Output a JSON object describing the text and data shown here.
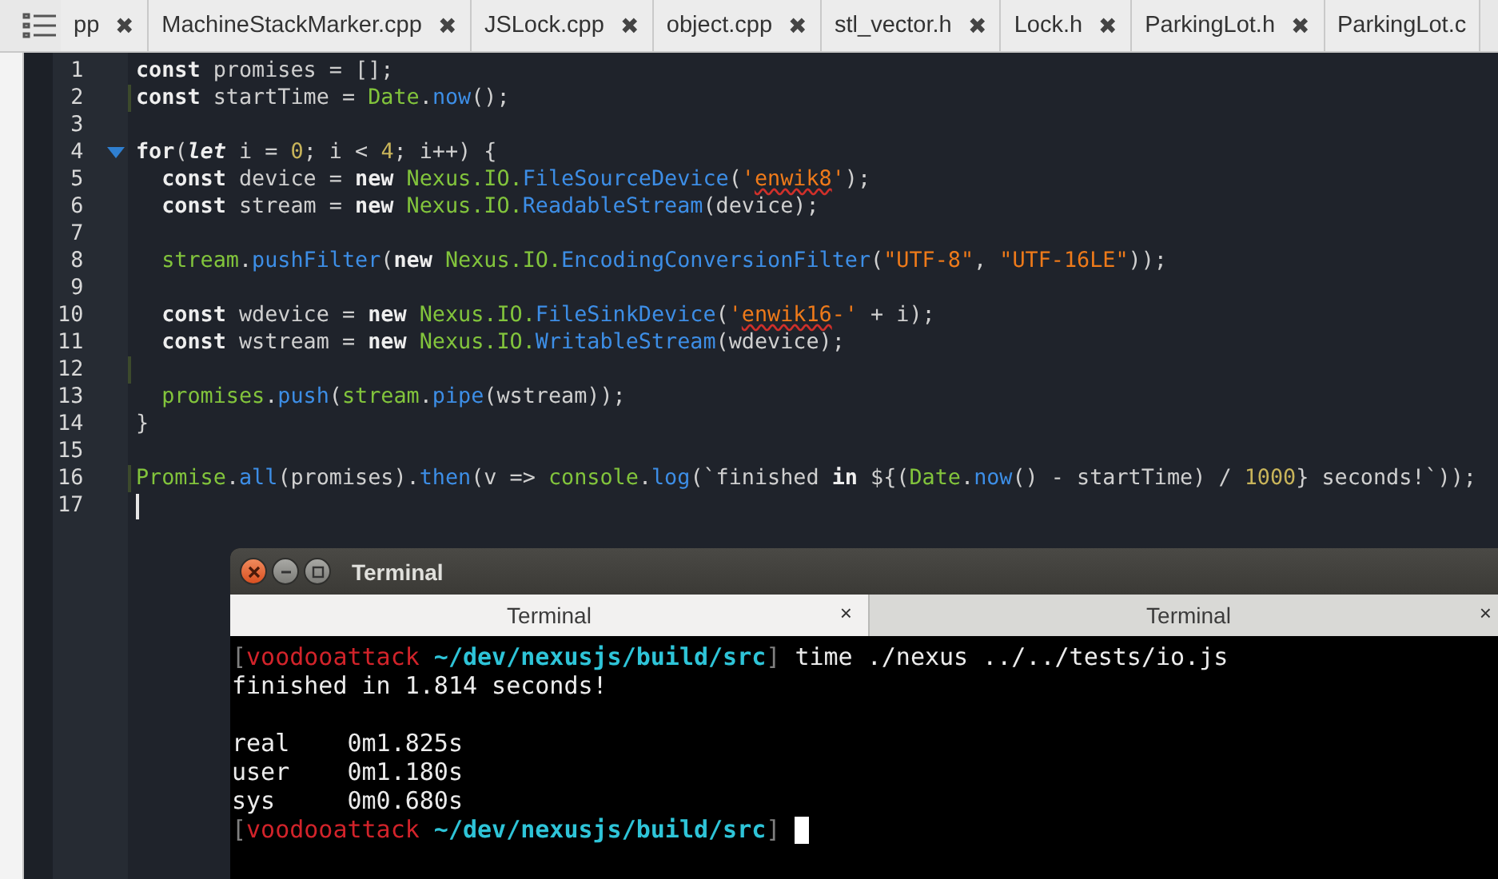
{
  "editor_tabs": [
    {
      "label": "pp",
      "close": "✖",
      "selected": false
    },
    {
      "label": "MachineStackMarker.cpp",
      "close": "✖",
      "selected": false
    },
    {
      "label": "JSLock.cpp",
      "close": "✖",
      "selected": false
    },
    {
      "label": "object.cpp",
      "close": "✖",
      "selected": false
    },
    {
      "label": "stl_vector.h",
      "close": "✖",
      "selected": false
    },
    {
      "label": "Lock.h",
      "close": "✖",
      "selected": false
    },
    {
      "label": "ParkingLot.h",
      "close": "✖",
      "selected": false
    },
    {
      "label": "ParkingLot.c",
      "selected": false
    }
  ],
  "code": {
    "lines": [
      {
        "number": "1",
        "foldable": false,
        "modified": false,
        "tokens": [
          {
            "kind": "keyword",
            "text": "const"
          },
          {
            "kind": "plain",
            "text": " promises = [];"
          }
        ]
      },
      {
        "number": "2",
        "foldable": false,
        "modified": true,
        "tokens": [
          {
            "kind": "keyword",
            "text": "const"
          },
          {
            "kind": "plain",
            "text": " startTime = "
          },
          {
            "kind": "object",
            "text": "Date"
          },
          {
            "kind": "plain",
            "text": "."
          },
          {
            "kind": "method",
            "text": "now"
          },
          {
            "kind": "plain",
            "text": "();"
          }
        ]
      },
      {
        "number": "3",
        "foldable": false,
        "modified": false
      },
      {
        "number": "4",
        "foldable": true,
        "modified": false,
        "tokens": [
          {
            "kind": "keyword",
            "text": "for"
          },
          {
            "kind": "plain",
            "text": "("
          },
          {
            "kind": "storage",
            "text": "let"
          },
          {
            "kind": "plain",
            "text": " i = "
          },
          {
            "kind": "number",
            "text": "0"
          },
          {
            "kind": "plain",
            "text": "; i < "
          },
          {
            "kind": "number",
            "text": "4"
          },
          {
            "kind": "plain",
            "text": "; i++) {"
          }
        ],
        "children": [
          {
            "number": "5",
            "foldable": false,
            "modified": false,
            "tokens": [
              {
                "kind": "keyword",
                "text": "const"
              },
              {
                "kind": "plain",
                "text": " device = "
              },
              {
                "kind": "keyword",
                "text": "new"
              },
              {
                "kind": "object",
                "text": " Nexus.IO."
              },
              {
                "kind": "method",
                "text": "FileSourceDevice"
              },
              {
                "kind": "plain",
                "text": "("
              },
              {
                "kind": "string",
                "text": "'"
              },
              {
                "kind": "flagged",
                "text": "enwik8"
              },
              {
                "kind": "string",
                "text": "'"
              },
              {
                "kind": "plain",
                "text": ");"
              }
            ]
          },
          {
            "number": "6",
            "foldable": false,
            "modified": false,
            "tokens": [
              {
                "kind": "keyword",
                "text": "const"
              },
              {
                "kind": "plain",
                "text": " stream = "
              },
              {
                "kind": "keyword",
                "text": "new"
              },
              {
                "kind": "object",
                "text": " Nexus.IO."
              },
              {
                "kind": "method",
                "text": "ReadableStream"
              },
              {
                "kind": "plain",
                "text": "(device);"
              }
            ]
          },
          {
            "number": "7",
            "foldable": false,
            "modified": false
          },
          {
            "number": "8",
            "foldable": false,
            "modified": false,
            "tokens": [
              {
                "kind": "object",
                "text": "stream"
              },
              {
                "kind": "plain",
                "text": "."
              },
              {
                "kind": "method",
                "text": "pushFilter"
              },
              {
                "kind": "plain",
                "text": "("
              },
              {
                "kind": "keyword",
                "text": "new"
              },
              {
                "kind": "object",
                "text": " Nexus.IO."
              },
              {
                "kind": "method",
                "text": "EncodingConversionFilter"
              },
              {
                "kind": "plain",
                "text": "("
              },
              {
                "kind": "string",
                "text": "\"UTF-8\""
              },
              {
                "kind": "plain",
                "text": ", "
              },
              {
                "kind": "string",
                "text": "\"UTF-16LE\""
              },
              {
                "kind": "plain",
                "text": "));"
              }
            ]
          },
          {
            "number": "9",
            "foldable": false,
            "modified": false
          },
          {
            "number": "10",
            "foldable": false,
            "modified": false,
            "tokens": [
              {
                "kind": "keyword",
                "text": "const"
              },
              {
                "kind": "plain",
                "text": " wdevice = "
              },
              {
                "kind": "keyword",
                "text": "new"
              },
              {
                "kind": "object",
                "text": " Nexus.IO."
              },
              {
                "kind": "method",
                "text": "FileSinkDevice"
              },
              {
                "kind": "plain",
                "text": "("
              },
              {
                "kind": "string",
                "text": "'"
              },
              {
                "kind": "flagged",
                "text": "enwik16"
              },
              {
                "kind": "string",
                "text": "-'"
              },
              {
                "kind": "plain",
                "text": " + i);"
              }
            ]
          },
          {
            "number": "11",
            "foldable": false,
            "modified": false,
            "tokens": [
              {
                "kind": "keyword",
                "text": "const"
              },
              {
                "kind": "plain",
                "text": " wstream = "
              },
              {
                "kind": "keyword",
                "text": "new"
              },
              {
                "kind": "object",
                "text": " Nexus.IO."
              },
              {
                "kind": "method",
                "text": "WritableStream"
              },
              {
                "kind": "plain",
                "text": "(wdevice);"
              }
            ]
          },
          {
            "number": "12",
            "foldable": false,
            "modified": true
          },
          {
            "number": "13",
            "foldable": false,
            "modified": false,
            "tokens": [
              {
                "kind": "object",
                "text": "promises"
              },
              {
                "kind": "plain",
                "text": "."
              },
              {
                "kind": "method",
                "text": "push"
              },
              {
                "kind": "plain",
                "text": "("
              },
              {
                "kind": "object",
                "text": "stream"
              },
              {
                "kind": "plain",
                "text": "."
              },
              {
                "kind": "method",
                "text": "pipe"
              },
              {
                "kind": "plain",
                "text": "(wstream));"
              }
            ]
          }
        ]
      },
      {
        "number": "14",
        "foldable": false,
        "modified": false,
        "tokens": [
          {
            "kind": "plain",
            "text": "}"
          }
        ]
      },
      {
        "number": "15",
        "foldable": false,
        "modified": false
      },
      {
        "number": "16",
        "foldable": false,
        "modified": true,
        "tokens": [
          {
            "kind": "object",
            "text": "Promise"
          },
          {
            "kind": "plain",
            "text": "."
          },
          {
            "kind": "method",
            "text": "all"
          },
          {
            "kind": "plain",
            "text": "(promises)."
          },
          {
            "kind": "method",
            "text": "then"
          },
          {
            "kind": "plain",
            "text": "(v => "
          },
          {
            "kind": "object",
            "text": "console"
          },
          {
            "kind": "plain",
            "text": "."
          },
          {
            "kind": "method",
            "text": "log"
          },
          {
            "kind": "plain",
            "text": "(`finished "
          },
          {
            "kind": "keyword",
            "text": "in"
          },
          {
            "kind": "plain",
            "text": " ${("
          },
          {
            "kind": "object",
            "text": "Date"
          },
          {
            "kind": "plain",
            "text": "."
          },
          {
            "kind": "method",
            "text": "now"
          },
          {
            "kind": "plain",
            "text": "() - startTime) / "
          },
          {
            "kind": "number",
            "text": "1000"
          },
          {
            "kind": "plain",
            "text": "} seconds!`));"
          }
        ]
      },
      {
        "number": "17",
        "foldable": false,
        "modified": false,
        "tokens": [
          {
            "kind": "cursor"
          }
        ]
      }
    ]
  },
  "terminal": {
    "title": "Terminal",
    "tabs": [
      {
        "label": "Terminal",
        "close": "×",
        "selected": true
      },
      {
        "label": "Terminal",
        "close": "×",
        "selected": false
      }
    ],
    "paragraphs": [
      {
        "lines": [
          {
            "segments": [
              {
                "kind": "bracket",
                "text": "["
              },
              {
                "kind": "user",
                "text": "voodooattack"
              },
              {
                "kind": "path",
                "text": " ~/dev/nexusjs/build/src"
              },
              {
                "kind": "bracket",
                "text": "]"
              },
              {
                "kind": "text",
                "text": " time ./nexus ../../tests/io.js"
              }
            ]
          },
          {
            "segments": [
              {
                "kind": "text",
                "text": "finished in 1.814 seconds!"
              }
            ]
          }
        ]
      },
      {
        "lines": [
          {
            "segments": [
              {
                "kind": "text",
                "text": "real\t0m1.825s"
              }
            ]
          },
          {
            "segments": [
              {
                "kind": "text",
                "text": "user\t0m1.180s"
              }
            ]
          },
          {
            "segments": [
              {
                "kind": "text",
                "text": "sys\t0m0.680s"
              }
            ]
          },
          {
            "segments": [
              {
                "kind": "bracket",
                "text": "["
              },
              {
                "kind": "user",
                "text": "voodooattack"
              },
              {
                "kind": "path",
                "text": " ~/dev/nexusjs/build/src"
              },
              {
                "kind": "bracket",
                "text": "]"
              },
              {
                "kind": "cursor"
              }
            ]
          }
        ]
      }
    ]
  }
}
